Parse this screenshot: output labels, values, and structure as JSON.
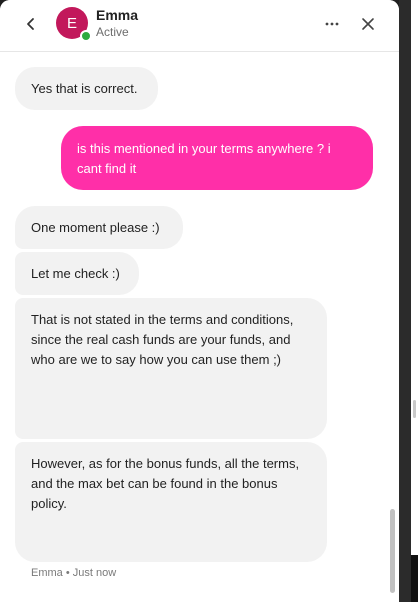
{
  "header": {
    "contact_name": "Emma",
    "status": "Active",
    "avatar_initial": "E",
    "back_icon": "chevron-left-icon",
    "more_icon": "ellipsis-icon",
    "close_icon": "close-icon"
  },
  "messages": [
    {
      "sender": "agent",
      "text": "Yes that is correct."
    },
    {
      "sender": "user",
      "text": "is this mentioned in your terms anywhere ? i cant find it"
    },
    {
      "sender": "agent",
      "text": "One moment please :)"
    },
    {
      "sender": "agent",
      "text": "Let me check :)"
    },
    {
      "sender": "agent",
      "text": "That is not stated in the terms and conditions, since the real cash funds are your funds, and who are we to say how you can use them ;)"
    },
    {
      "sender": "agent",
      "text": "However, as for the bonus funds, all the terms, and the max bet can be found in the bonus policy."
    }
  ],
  "footer_meta": "Emma • Just now",
  "colors": {
    "user_bubble": "#ff2fa8",
    "agent_bubble": "#f2f2f2",
    "avatar": "#c2185b",
    "online": "#2eaa3f"
  }
}
